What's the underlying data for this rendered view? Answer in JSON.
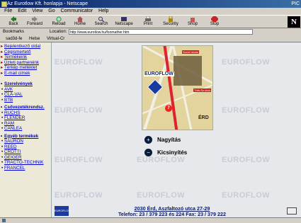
{
  "window": {
    "title": "Az Eurotlow Kft. honlapja - Netscape",
    "right_label": "PIC"
  },
  "menu": [
    "File",
    "Edit",
    "View",
    "Go",
    "Communicator",
    "Help"
  ],
  "toolbar": [
    "Back",
    "Forward",
    "Reload",
    "Home",
    "Search",
    "Netscape",
    "Print",
    "Security",
    "Shop",
    "Stop"
  ],
  "location": {
    "bookmarks_label": "Bookmarks",
    "label": "Location:",
    "url": "http://www.eurotlow.hu/foomather.htm"
  },
  "links": [
    "sad3d-fe",
    "Helse",
    "Virtual-Cr"
  ],
  "sidebar": {
    "top_links": [
      "Bejelentkező oldal",
      "Cégismertető",
      "Termékeink",
      "Üzleti partnereink",
      "Térkép melléklet",
      "E-mail címek"
    ],
    "sections": [
      {
        "title": "Szerelvények",
        "items": [
          "AVK",
          "CLA-VAL",
          "BTB"
        ]
      },
      {
        "title": "Csőveze­ték­rendsz.",
        "items": [
          "RUCHS",
          "FLENDER",
          "RAM",
          "CANLEA"
        ]
      },
      {
        "title": "Egyéb termékek",
        "items": [
          "SAURON",
          "REED",
          "CROTTI",
          "GEIGER",
          "TRACTO-TECHNIK",
          "FRANCEL"
        ]
      }
    ]
  },
  "map": {
    "brand": "EUROFLOW",
    "city": "ÉRD",
    "route_number": "7",
    "labels": [
      "Szent István",
      "Tóth-Sz.utca"
    ]
  },
  "actions": {
    "zoom_in": "Nagyítás",
    "zoom_out": "Kicsinyítés"
  },
  "watermark": "EUROFLOW",
  "footer": {
    "address": "2030 Érd, Aszfaltozó utca 27-29",
    "phone": "Telefon: 23 / 379 223 és 224  Fax: 23 / 379 222",
    "logo_text": "EUROFLOW"
  },
  "colors": {
    "link": "#0000cc",
    "title_bar": "#0a246a",
    "map_bg": "#e3d39c"
  }
}
